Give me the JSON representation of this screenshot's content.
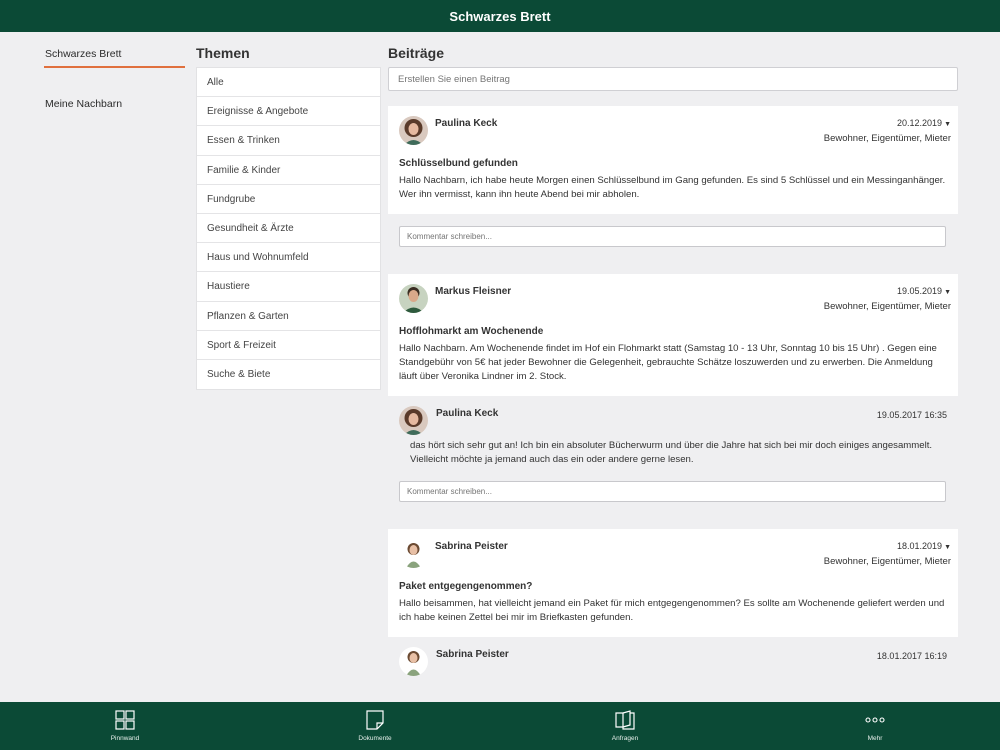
{
  "header": {
    "title": "Schwarzes Brett"
  },
  "leftnav": {
    "items": [
      {
        "label": "Schwarzes Brett",
        "active": true
      },
      {
        "label": "Meine Nachbarn",
        "active": false
      }
    ]
  },
  "topics": {
    "title": "Themen",
    "items": [
      "Alle",
      "Ereignisse & Angebote",
      "Essen & Trinken",
      "Familie & Kinder",
      "Fundgrube",
      "Gesundheit & Ärzte",
      "Haus und Wohnumfeld",
      "Haustiere",
      "Pflanzen & Garten",
      "Sport & Freizeit",
      "Suche & Biete"
    ]
  },
  "posts": {
    "title": "Beiträge",
    "new_post_placeholder": "Erstellen Sie einen Beitrag",
    "comment_placeholder": "Kommentar schreiben...",
    "items": [
      {
        "author": "Paulina Keck",
        "date": "20.12.2019",
        "audience": "Bewohner, Eigentümer, Mieter",
        "title": "Schlüsselbund gefunden",
        "body": "Hallo Nachbarn, ich habe heute Morgen einen Schlüsselbund im Gang gefunden. Es sind 5 Schlüssel und ein Messinganhänger. Wer ihn vermisst, kann ihn heute Abend bei mir abholen."
      },
      {
        "author": "Markus Fleisner",
        "date": "19.05.2019",
        "audience": "Bewohner, Eigentümer, Mieter",
        "title": "Hofflohmarkt am Wochenende",
        "body": "Hallo Nachbarn. Am Wochenende findet im Hof ein Flohmarkt statt (Samstag 10 - 13 Uhr, Sonntag 10 bis 15 Uhr) . Gegen eine Standgebühr von 5€ hat jeder Bewohner die Gelegenheit, gebrauchte Schätze loszuwerden und zu erwerben. Die Anmeldung läuft über Veronika Lindner im 2. Stock.",
        "reply": {
          "author": "Paulina Keck",
          "date": "19.05.2017 16:35",
          "body": "das hört sich sehr gut an! Ich bin ein absoluter Bücherwurm und über die Jahre hat sich bei mir doch einiges angesammelt. Vielleicht möchte ja jemand auch das ein oder andere gerne lesen."
        }
      },
      {
        "author": "Sabrina Peister",
        "date": "18.01.2019",
        "audience": "Bewohner, Eigentümer, Mieter",
        "title": "Paket entgegengenommen?",
        "body": "Hallo beisammen, hat vielleicht jemand ein Paket für mich entgegengenommen? Es sollte am Wochenende geliefert werden und ich habe keinen Zettel bei mir im Briefkasten gefunden.",
        "reply": {
          "author": "Sabrina Peister",
          "date": "18.01.2017 16:19"
        }
      }
    ]
  },
  "bottom_tabs": [
    {
      "label": "Pinnwand",
      "icon": "grid-icon"
    },
    {
      "label": "Dokumente",
      "icon": "document-icon"
    },
    {
      "label": "Anfragen",
      "icon": "book-icon"
    },
    {
      "label": "Mehr",
      "icon": "more-icon"
    }
  ],
  "colors": {
    "brand": "#0b4a36",
    "accent": "#e0703e",
    "background": "#efeff1"
  }
}
